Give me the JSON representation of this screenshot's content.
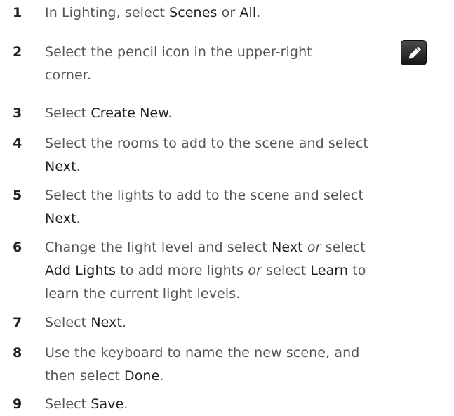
{
  "steps": [
    {
      "number": "1",
      "lines": [
        [
          {
            "t": "In Lighting, select "
          },
          {
            "t": "Scenes",
            "k": true
          },
          {
            "t": " or "
          },
          {
            "t": "All",
            "k": true
          },
          {
            "t": "."
          }
        ]
      ]
    },
    {
      "number": "2",
      "lines": [
        [
          {
            "t": "Select the pencil icon in the upper-right"
          }
        ],
        [
          {
            "t": "corner."
          }
        ]
      ]
    },
    {
      "number": "3",
      "lines": [
        [
          {
            "t": "Select "
          },
          {
            "t": "Create New",
            "k": true
          },
          {
            "t": "."
          }
        ]
      ]
    },
    {
      "number": "4",
      "lines": [
        [
          {
            "t": "Select the rooms to add to the scene and select"
          }
        ],
        [
          {
            "t": "Next",
            "k": true
          },
          {
            "t": "."
          }
        ]
      ]
    },
    {
      "number": "5",
      "lines": [
        [
          {
            "t": "Select the lights to add to the scene and select"
          }
        ],
        [
          {
            "t": "Next",
            "k": true
          },
          {
            "t": "."
          }
        ]
      ]
    },
    {
      "number": "6",
      "lines": [
        [
          {
            "t": "Change the light level and select "
          },
          {
            "t": "Next",
            "k": true
          },
          {
            "t": " "
          },
          {
            "t": "or",
            "e": true
          },
          {
            "t": " select"
          }
        ],
        [
          {
            "t": "Add Lights",
            "k": true
          },
          {
            "t": " to add more lights "
          },
          {
            "t": "or",
            "e": true
          },
          {
            "t": " select "
          },
          {
            "t": "Learn",
            "k": true
          },
          {
            "t": " to"
          }
        ],
        [
          {
            "t": "learn the current light levels."
          }
        ]
      ]
    },
    {
      "number": "7",
      "lines": [
        [
          {
            "t": "Select "
          },
          {
            "t": "Next",
            "k": true
          },
          {
            "t": "."
          }
        ]
      ]
    },
    {
      "number": "8",
      "lines": [
        [
          {
            "t": "Use the keyboard to name the new scene, and"
          }
        ],
        [
          {
            "t": "then select "
          },
          {
            "t": "Done",
            "k": true
          },
          {
            "t": "."
          }
        ]
      ]
    },
    {
      "number": "9",
      "lines": [
        [
          {
            "t": "Select "
          },
          {
            "t": "Save",
            "k": true
          },
          {
            "t": "."
          }
        ]
      ]
    }
  ],
  "icons": {
    "pencil": "pencil-icon"
  },
  "colors": {
    "number": "#222222",
    "body_text": "#555555",
    "keyword": "#222222",
    "icon_bg": "#2a2a2a"
  }
}
